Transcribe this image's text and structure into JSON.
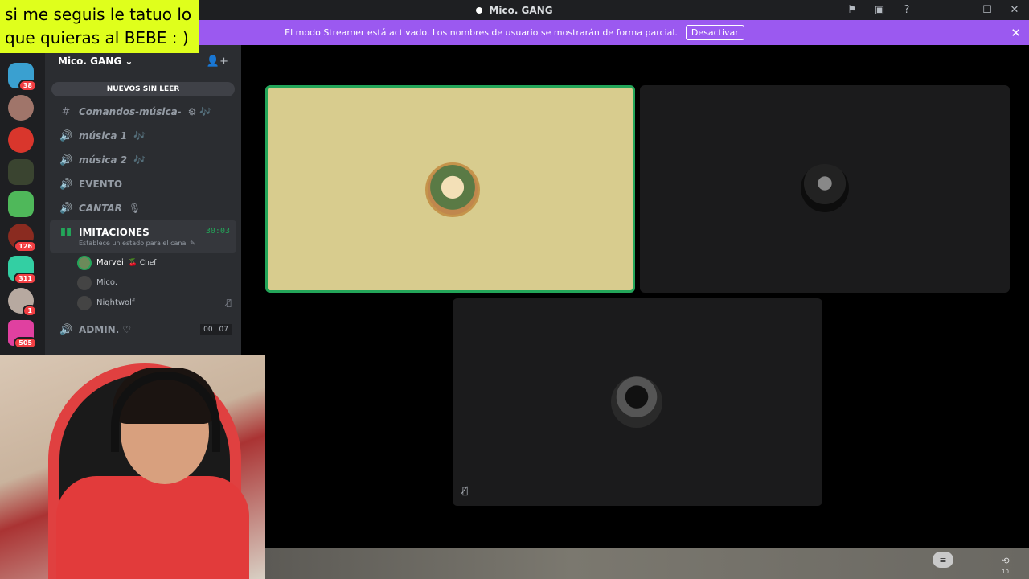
{
  "caption": {
    "line1": "si me seguis le tatuo lo",
    "line2": "que quieras al BEBE : )"
  },
  "titlebar": {
    "title": "Mico. GANG"
  },
  "banner": {
    "message": "El modo Streamer está activado. Los nombres de usuario se mostrarán de forma parcial.",
    "button": "Desactivar",
    "close": "✕"
  },
  "servers": [
    {
      "badge": "38"
    },
    {
      "badge": ""
    },
    {
      "badge": ""
    },
    {
      "badge": ""
    },
    {
      "badge": ""
    },
    {
      "badge": "126"
    },
    {
      "badge": "311"
    },
    {
      "badge": "1"
    },
    {
      "badge": "505"
    }
  ],
  "guild": {
    "name": "Mico. GANG ⌄",
    "unread_label": "NUEVOS SIN LEER"
  },
  "channels": [
    {
      "label": "Comandos-música-",
      "icon": "#",
      "suffix": "⚙ 🎶"
    },
    {
      "label": "música 1",
      "icon": "🔊",
      "suffix": "🎶"
    },
    {
      "label": "música 2",
      "icon": "🔊",
      "suffix": "🎶"
    },
    {
      "label": "EVENTO",
      "icon": "🔊",
      "suffix": ""
    },
    {
      "label": "CANTAR",
      "icon": "🔊",
      "suffix": "🎙"
    }
  ],
  "active_channel": {
    "label": "IMITACIONES",
    "timer": "30:03",
    "status": "Establece un estado para el canal ✎",
    "users": [
      {
        "name": "Marvei",
        "tag": "🍒 Chef",
        "muted": false
      },
      {
        "name": "Mico.",
        "tag": "",
        "muted": false
      },
      {
        "name": "Nightwolf",
        "tag": "",
        "muted": true
      }
    ]
  },
  "admin_channel": {
    "label": "ADMIN. ♡",
    "count_a": "00",
    "count_b": "07"
  },
  "stage": {
    "tile_mute_icon": "🎙̸"
  },
  "bottombar": {
    "icon_right_label": "10"
  }
}
